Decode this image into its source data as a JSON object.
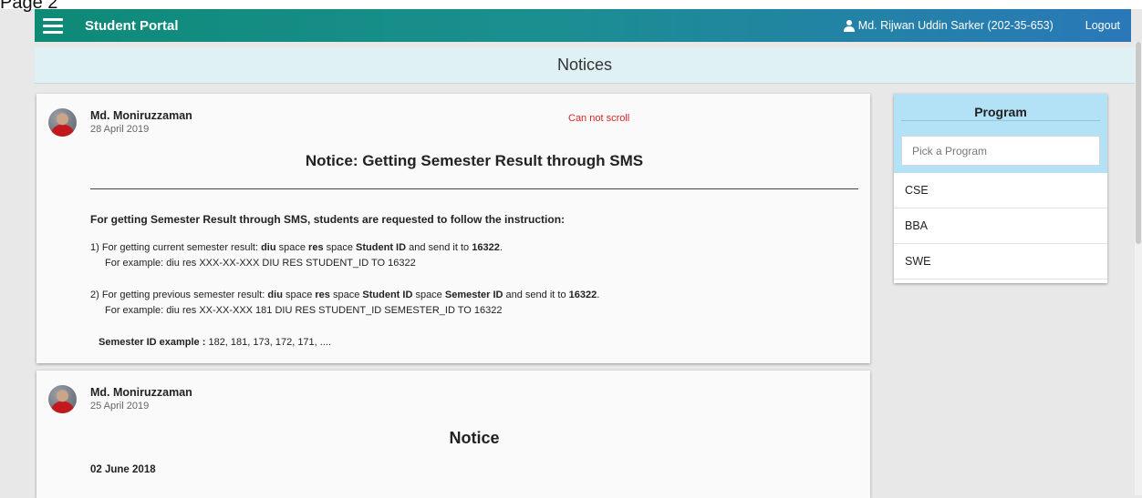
{
  "window": {
    "partial_label": "Page 2"
  },
  "navbar": {
    "menu_icon": "hamburger-menu-icon",
    "brand": "Student Portal",
    "user_icon": "user-icon",
    "user_name": "Md. Rijwan Uddin Sarker (202-35-653)",
    "logout": "Logout",
    "gradient": [
      "#0e8a77",
      "#2a78b8"
    ]
  },
  "page_header": {
    "title": "Notices"
  },
  "notices": [
    {
      "author": "Md. Moniruzzaman",
      "date": "28 April 2019",
      "overlay_note": "Can not scroll",
      "title": "Notice: Getting Semester Result through SMS",
      "intro": "For getting Semester Result through SMS, students are requested to follow the instruction:",
      "item1": {
        "prefix": "1)  For getting current semester result: ",
        "cmd1": "diu",
        "sp1": " space ",
        "cmd2": "res",
        "sp2": " space ",
        "cmd3": "Student ID",
        "suffix": " and send it to ",
        "number": "16322",
        "end": ".",
        "example": "For example: diu res XXX-XX-XXX DIU RES STUDENT_ID TO 16322"
      },
      "item2": {
        "prefix": "2) For getting previous semester result: ",
        "cmd1": "diu",
        "sp1": " space ",
        "cmd2": "res",
        "sp2": " space ",
        "cmd3": "Student ID",
        "sp3": " space ",
        "cmd4": "Semester ID",
        "suffix": " and send it to ",
        "number": "16322",
        "end": ".",
        "example": "For example: diu res XX-XX-XXX 181 DIU RES STUDENT_ID SEMESTER_ID TO 16322"
      },
      "semester_label": "Semester ID example : ",
      "semester_values": "182, 181, 173, 172, 171, ...."
    },
    {
      "author": "Md. Moniruzzaman",
      "date": "25 April 2019",
      "title": "Notice",
      "subdate": "02 June 2018"
    }
  ],
  "sidebar": {
    "title": "Program",
    "search_placeholder": "Pick a Program",
    "programs": [
      "CSE",
      "BBA",
      "SWE"
    ]
  }
}
